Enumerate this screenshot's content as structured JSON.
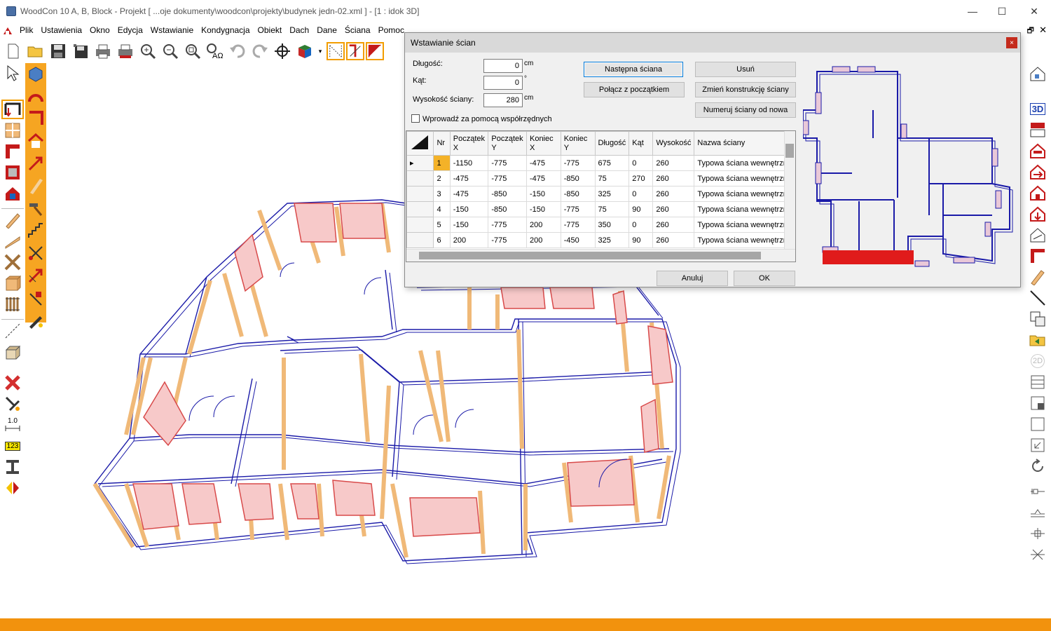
{
  "window": {
    "title": "WoodCon 10 A, B, Block - Projekt [ ...oje dokumenty\\woodcon\\projekty\\budynek jedn-02.xml ]  - [1 : idok 3D]",
    "minimize": "—",
    "maximize": "☐",
    "close": "✕",
    "mdi_restore": "🗗",
    "mdi_close": "✕"
  },
  "menu": [
    "Plik",
    "Ustawienia",
    "Okno",
    "Edycja",
    "Wstawianie",
    "Kondygnacja",
    "Obiekt",
    "Dach",
    "Dane",
    "Ściana",
    "Pomoc"
  ],
  "toolbar_icons": [
    "new-icon",
    "open-icon",
    "save-icon",
    "save-all-icon",
    "print-icon",
    "print-preview-icon",
    "zoom-in-icon",
    "zoom-out-icon",
    "zoom-window-icon",
    "text-style-icon",
    "undo-icon",
    "redo-icon",
    "crosshair-icon",
    "cube-color-icon"
  ],
  "dialog": {
    "title": "Wstawianie ścian",
    "close": "×",
    "length_label": "Długość:",
    "length_value": "0",
    "length_unit": "cm",
    "angle_label": "Kąt:",
    "angle_value": "0",
    "angle_unit": "°",
    "height_label": "Wysokość ściany:",
    "height_value": "280",
    "height_unit": "cm",
    "coords_checkbox": "Wprowadź za pomocą współrzędnych",
    "btn_next_wall": "Następna ściana",
    "btn_connect_start": "Połącz z początkiem",
    "btn_delete": "Usuń",
    "btn_change_construction": "Zmień konstrukcję ściany",
    "btn_renumber": "Numeruj ściany od nowa",
    "btn_cancel": "Anuluj",
    "btn_ok": "OK",
    "columns": [
      "Nr",
      "Początek X",
      "Początek Y",
      "Koniec X",
      "Koniec Y",
      "Długość",
      "Kąt",
      "Wysokość",
      "Nazwa ściany"
    ],
    "rows": [
      [
        "1",
        "-1150",
        "-775",
        "-475",
        "-775",
        "675",
        "0",
        "260",
        "Typowa ściana wewnętrzna"
      ],
      [
        "2",
        "-475",
        "-775",
        "-475",
        "-850",
        "75",
        "270",
        "260",
        "Typowa ściana wewnętrzna"
      ],
      [
        "3",
        "-475",
        "-850",
        "-150",
        "-850",
        "325",
        "0",
        "260",
        "Typowa ściana wewnętrzna"
      ],
      [
        "4",
        "-150",
        "-850",
        "-150",
        "-775",
        "75",
        "90",
        "260",
        "Typowa ściana wewnętrzna"
      ],
      [
        "5",
        "-150",
        "-775",
        "200",
        "-775",
        "350",
        "0",
        "260",
        "Typowa ściana wewnętrzna"
      ],
      [
        "6",
        "200",
        "-775",
        "200",
        "-450",
        "325",
        "90",
        "260",
        "Typowa ściana wewnętrzna"
      ]
    ]
  },
  "right_toolbar_labels": {
    "view3d": "3D",
    "view2d": "2D"
  },
  "left_toolbar_labels": {
    "scale": "1.0",
    "numbering": "123"
  },
  "colors": {
    "accent": "#f6a522",
    "status": "#f2920d",
    "wall_line": "#1a1aa8",
    "timber": "#f0b978",
    "window_fill": "#f7c9c9",
    "selection": "#f4b228"
  }
}
